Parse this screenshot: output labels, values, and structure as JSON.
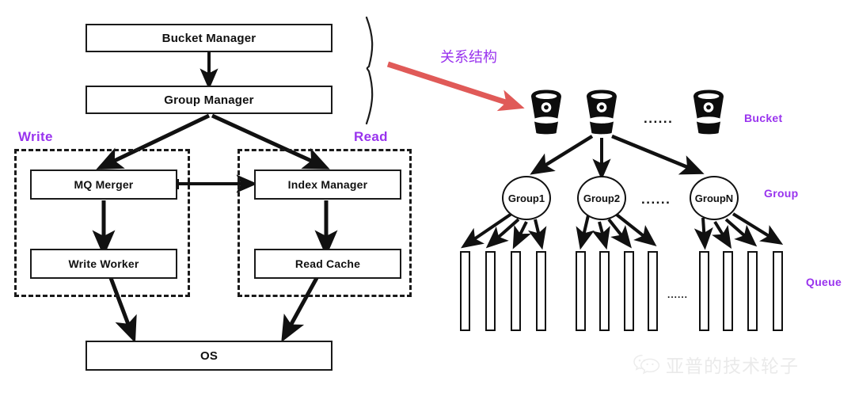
{
  "diagram": {
    "title_annotation_cn": "关系结构",
    "colors": {
      "accent_purple": "#9933ee",
      "arrow_red": "#e05a58",
      "stroke_black": "#111111",
      "background": "#ffffff"
    },
    "left_architecture": {
      "boxes": [
        {
          "label": "Bucket Manager"
        },
        {
          "label": "Group Manager"
        },
        {
          "label": "MQ Merger"
        },
        {
          "label": "Index Manager"
        },
        {
          "label": "Write Worker"
        },
        {
          "label": "Read Cache"
        },
        {
          "label": "OS"
        }
      ],
      "group_labels": [
        {
          "label": "Write"
        },
        {
          "label": "Read"
        }
      ]
    },
    "right_hierarchy": {
      "tier_labels": [
        {
          "label": "Bucket"
        },
        {
          "label": "Group"
        },
        {
          "label": "Queue"
        }
      ],
      "buckets": [
        {
          "name": "bucket-1"
        },
        {
          "name": "bucket-2"
        },
        {
          "name": "bucket-n"
        }
      ],
      "bucket_ellipsis": "......",
      "groups": [
        {
          "label": "Group1"
        },
        {
          "label": "Group2"
        },
        {
          "label": "GroupN"
        }
      ],
      "group_ellipsis": "......",
      "queue_ellipsis": "......",
      "queues_per_group": 4,
      "queue_group_count": 3
    }
  },
  "watermark": {
    "text": "亚普的技术轮子",
    "icon": "wechat-icon"
  }
}
